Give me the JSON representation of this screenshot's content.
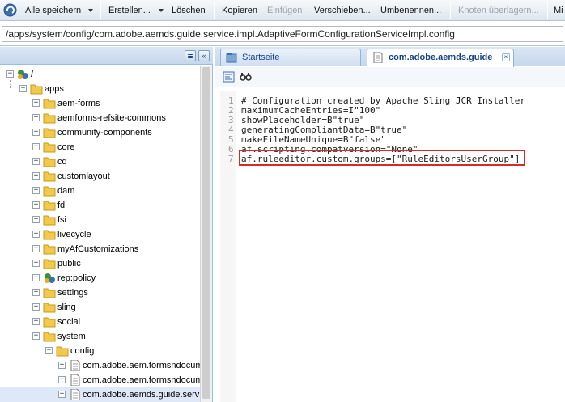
{
  "toolbar": {
    "save_all": "Alle speichern",
    "create": "Erstellen...",
    "delete": "Löschen",
    "copy": "Kopieren",
    "paste": "Einfügen",
    "move": "Verschieben...",
    "rename": "Umbenennen...",
    "overlay": "Knoten überlagern...",
    "more": "Mi"
  },
  "path": {
    "value": "/apps/system/config/com.adobe.aemds.guide.service.impl.AdaptiveFormConfigurationServiceImpl.config"
  },
  "left_panel": {
    "collapse_label": "«",
    "filter_label": "≣"
  },
  "tree": {
    "root": "/",
    "apps": "apps",
    "items": [
      "aem-forms",
      "aemforms-refsite-commons",
      "community-components",
      "core",
      "cq",
      "customlayout",
      "dam",
      "fd",
      "fsi",
      "livecycle",
      "myAfCustomizations",
      "public",
      "rep:policy",
      "settings",
      "sling",
      "social"
    ],
    "system": "system",
    "config": "config",
    "config_children": [
      "com.adobe.aem.formsndocum",
      "com.adobe.aem.formsndocum",
      "com.adobe.aemds.guide.serv"
    ],
    "toggle_plus": "+",
    "toggle_minus": "−"
  },
  "tabs": {
    "home": "Startseite",
    "file": "com.adobe.aemds.guide",
    "close": "×"
  },
  "editor": {
    "lines": [
      {
        "num": "1",
        "code": "# Configuration created by Apache Sling JCR Installer"
      },
      {
        "num": "2",
        "code": "maximumCacheEntries=I\"100\""
      },
      {
        "num": "3",
        "code": "showPlaceholder=B\"true\""
      },
      {
        "num": "4",
        "code": "generatingCompliantData=B\"true\""
      },
      {
        "num": "5",
        "code": "makeFileNameUnique=B\"false\""
      },
      {
        "num": "6",
        "code": "af.scripting.compatversion=\"None\""
      },
      {
        "num": "7",
        "code": "af.ruleeditor.custom.groups=[\"RuleEditorsUserGroup\"]"
      }
    ]
  },
  "colors": {
    "highlight": "#d42b2b",
    "panel_header": "#c7d8ec",
    "tab_text": "#15428b"
  }
}
